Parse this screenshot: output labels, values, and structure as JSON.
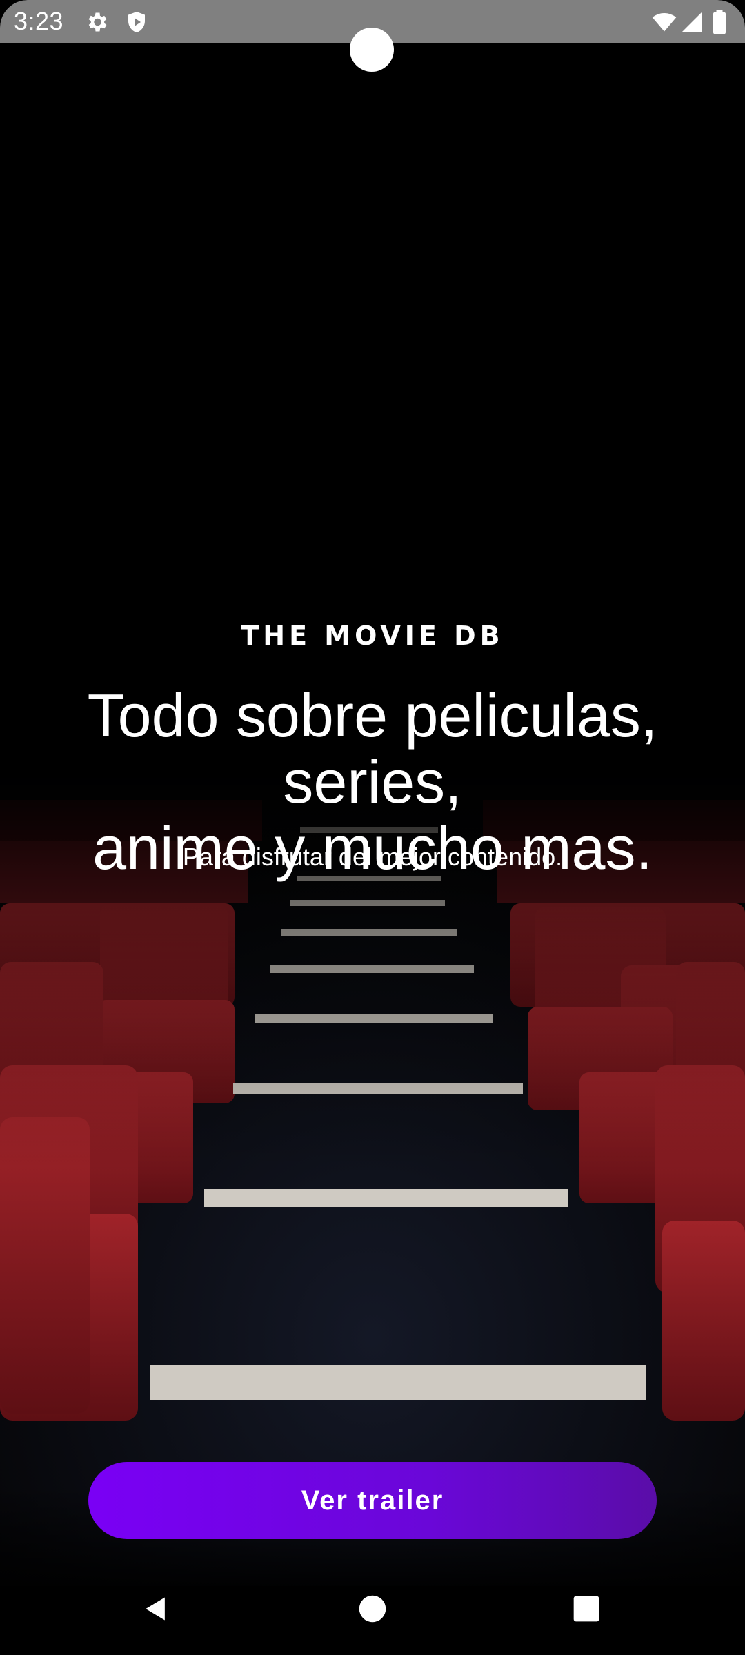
{
  "status_bar": {
    "time": "3:23",
    "icons": [
      "gear-icon",
      "shield-icon",
      "wifi-icon",
      "signal-icon",
      "battery-icon"
    ]
  },
  "onboarding": {
    "brand": "THE MOVIE DB",
    "headline_line1": "Todo sobre peliculas, series,",
    "headline_line2": "anime y mucho mas.",
    "subtitle": "Para disfrutar del mejor contenido.",
    "cta_label": "Ver trailer"
  },
  "nav_bar": {
    "items": [
      "back-icon",
      "home-icon",
      "recents-icon"
    ]
  },
  "colors": {
    "accent": "#7a00f5",
    "seat_red": "#8b1a1f",
    "background": "#000000",
    "status_bar": "#808080"
  }
}
